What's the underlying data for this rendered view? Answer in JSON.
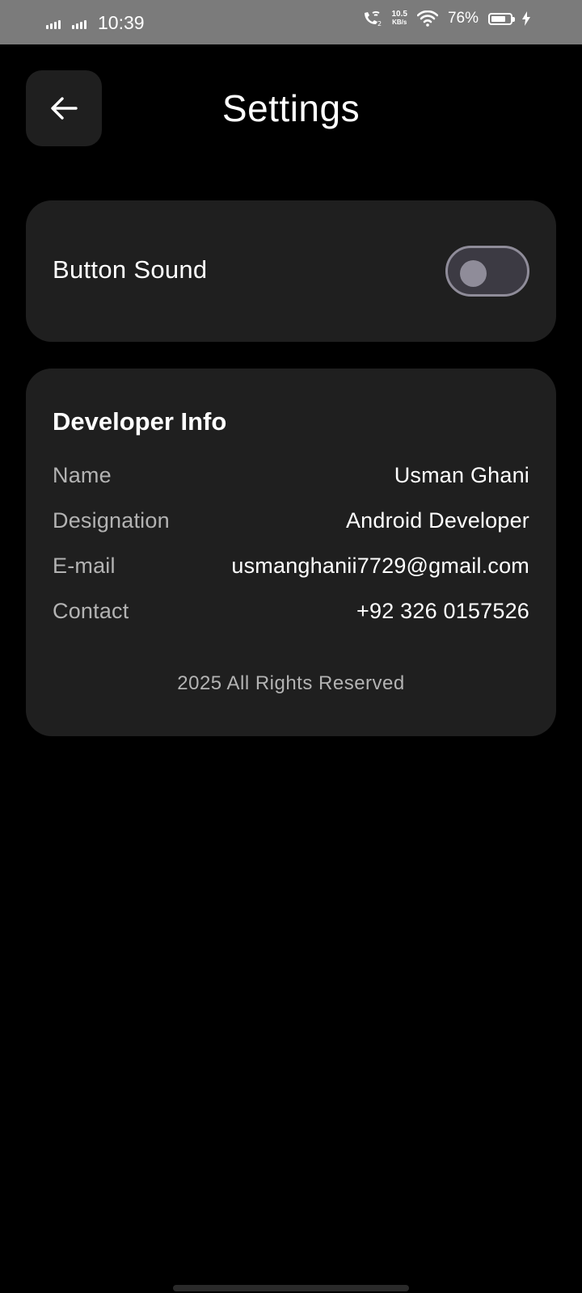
{
  "status_bar": {
    "time": "10:39",
    "net_speed_value": "10.5",
    "net_speed_unit": "KB/s",
    "battery_percent": "76%",
    "battery_level": 0.76,
    "icons": [
      "signal-icon",
      "signal-icon",
      "wifi-call-icon",
      "wifi-icon",
      "battery-icon",
      "charging-icon"
    ]
  },
  "header": {
    "title": "Settings",
    "back_icon": "arrow-left-icon"
  },
  "sound_setting": {
    "label": "Button Sound",
    "enabled": false
  },
  "developer_info": {
    "title": "Developer Info",
    "rows": [
      {
        "key": "Name",
        "value": "Usman Ghani"
      },
      {
        "key": "Designation",
        "value": "Android Developer"
      },
      {
        "key": "E-mail",
        "value": "usmanghanii7729@gmail.com"
      },
      {
        "key": "Contact",
        "value": "+92 326 0157526"
      }
    ],
    "footer": "2025 All Rights Reserved"
  },
  "colors": {
    "background": "#000000",
    "card": "#1f1f1f",
    "status_bar": "#7b7b7b",
    "toggle_track": "#3c3a43",
    "toggle_outline": "#8f8c99",
    "muted_text": "#b3b3b3"
  }
}
